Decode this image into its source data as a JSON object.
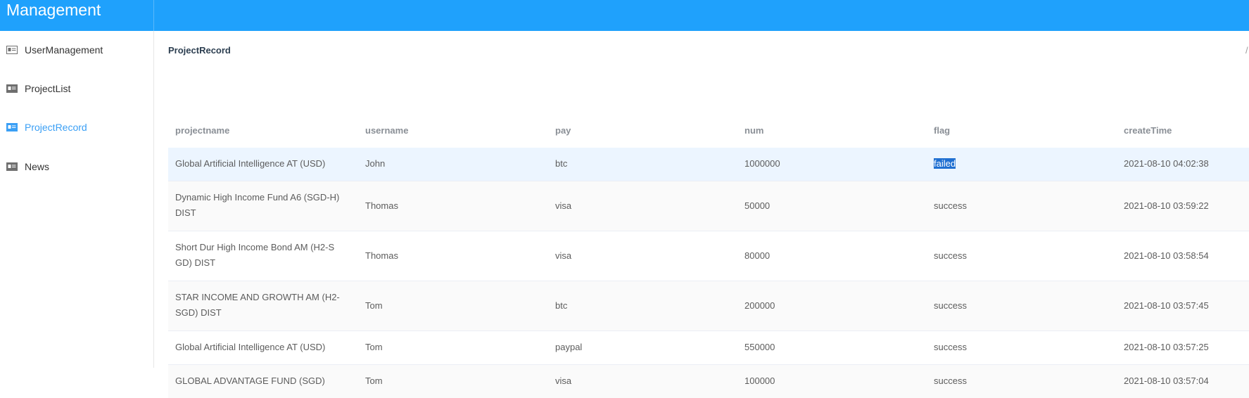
{
  "app": {
    "title": "Management"
  },
  "sidebar": {
    "items": [
      {
        "label": "UserManagement",
        "icon": "id-card-icon"
      },
      {
        "label": "ProjectList",
        "icon": "id-card-icon"
      },
      {
        "label": "ProjectRecord",
        "icon": "id-card-icon",
        "active": true
      },
      {
        "label": "News",
        "icon": "id-card-icon"
      }
    ]
  },
  "page": {
    "title": "ProjectRecord",
    "breadcrumb_separator": "/"
  },
  "table": {
    "columns": [
      "projectname",
      "username",
      "pay",
      "num",
      "flag",
      "createTime"
    ],
    "rows": [
      {
        "projectname": "Global Artificial Intelligence AT (USD)",
        "username": "John",
        "pay": "btc",
        "num": "1000000",
        "flag": "failed",
        "createTime": "2021-08-10 04:02:38"
      },
      {
        "projectname_line1": "Dynamic High Income Fund A6 (SGD-H)",
        "projectname_line2": "DIST",
        "username": "Thomas",
        "pay": "visa",
        "num": "50000",
        "flag": "success",
        "createTime": "2021-08-10 03:59:22"
      },
      {
        "projectname_line1": "Short Dur High Income Bond AM (H2-S",
        "projectname_line2": "GD) DIST",
        "username": "Thomas",
        "pay": "visa",
        "num": "80000",
        "flag": "success",
        "createTime": "2021-08-10 03:58:54"
      },
      {
        "projectname_line1": "STAR INCOME AND GROWTH AM (H2-",
        "projectname_line2": "SGD) DIST",
        "username": "Tom",
        "pay": "btc",
        "num": "200000",
        "flag": "success",
        "createTime": "2021-08-10 03:57:45"
      },
      {
        "projectname": "Global Artificial Intelligence AT (USD)",
        "username": "Tom",
        "pay": "paypal",
        "num": "550000",
        "flag": "success",
        "createTime": "2021-08-10 03:57:25"
      },
      {
        "projectname": "GLOBAL ADVANTAGE FUND (SGD)",
        "username": "Tom",
        "pay": "visa",
        "num": "100000",
        "flag": "success",
        "createTime": "2021-08-10 03:57:04"
      }
    ]
  },
  "colors": {
    "header": "#1fa1fc",
    "active_nav": "#3a9ff5",
    "row_hover": "#ecf5ff",
    "row_stripe": "#fafafa",
    "selection": "#1f6fd1"
  }
}
